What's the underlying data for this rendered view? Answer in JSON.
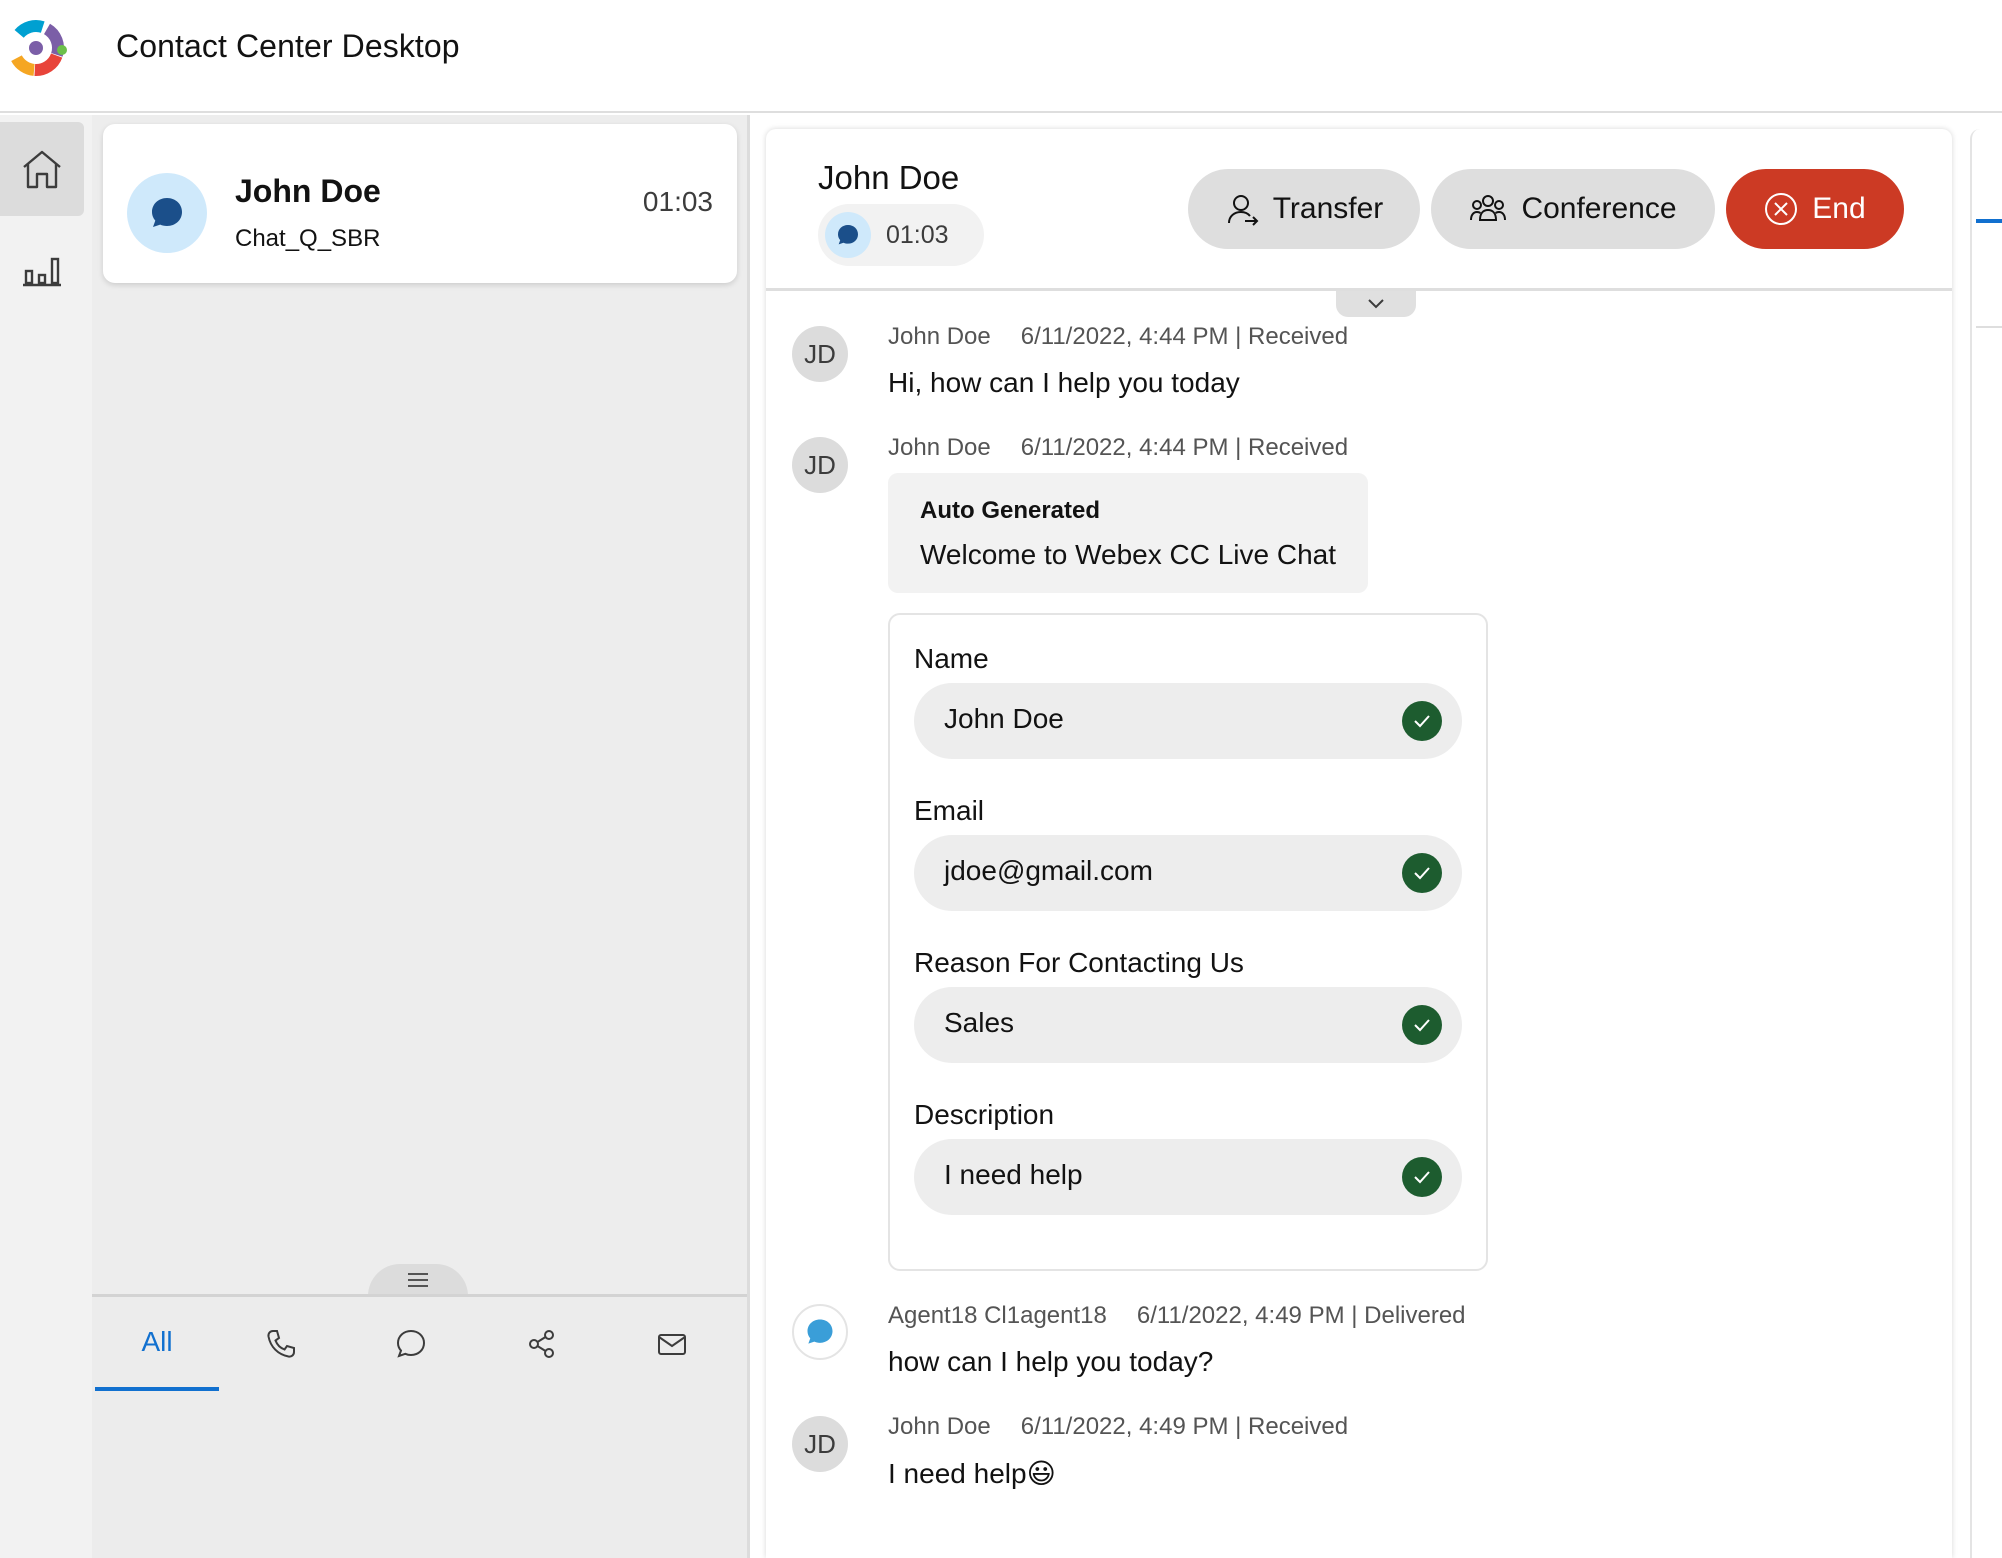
{
  "app": {
    "title": "Contact Center Desktop"
  },
  "nav": {
    "items": [
      {
        "icon": "home-icon",
        "active": true
      },
      {
        "icon": "stats-icon",
        "active": false
      }
    ]
  },
  "tasklist": {
    "card": {
      "name": "John Doe",
      "queue": "Chat_Q_SBR",
      "timer": "01:03",
      "channel_icon": "chat-icon"
    },
    "filters": [
      {
        "label": "All",
        "active": true
      },
      {
        "icon": "phone-icon"
      },
      {
        "icon": "chat-icon"
      },
      {
        "icon": "share-icon"
      },
      {
        "icon": "mail-icon"
      }
    ]
  },
  "interaction": {
    "customer_name": "John Doe",
    "timer": "01:03",
    "buttons": {
      "transfer": "Transfer",
      "conference": "Conference",
      "end": "End"
    }
  },
  "messages": [
    {
      "avatar": "JD",
      "sender": "John Doe",
      "meta": "6/11/2022, 4:44 PM | Received",
      "text": "Hi, how can I help you today"
    },
    {
      "avatar": "JD",
      "sender": "John Doe",
      "meta": "6/11/2022, 4:44 PM | Received",
      "auto_title": "Auto Generated",
      "text": "Welcome to Webex CC Live Chat"
    },
    {
      "avatar_icon": "chat-icon",
      "sender": "Agent18 Cl1agent18",
      "meta": "6/11/2022, 4:49 PM | Delivered",
      "text": "how can I help you today?"
    },
    {
      "avatar": "JD",
      "sender": "John Doe",
      "meta": "6/11/2022, 4:49 PM | Received",
      "text": "I need help😃"
    }
  ],
  "form": {
    "fields": [
      {
        "label": "Name",
        "value": "John Doe"
      },
      {
        "label": "Email",
        "value": "jdoe@gmail.com"
      },
      {
        "label": "Reason For Contacting Us",
        "value": "Sales"
      },
      {
        "label": "Description",
        "value": "I need help"
      }
    ]
  },
  "colors": {
    "accent": "#1170cf",
    "end_button": "#cc3a24",
    "check": "#1d5c2f",
    "chat_bubble_icon": "#1b4f8a"
  }
}
